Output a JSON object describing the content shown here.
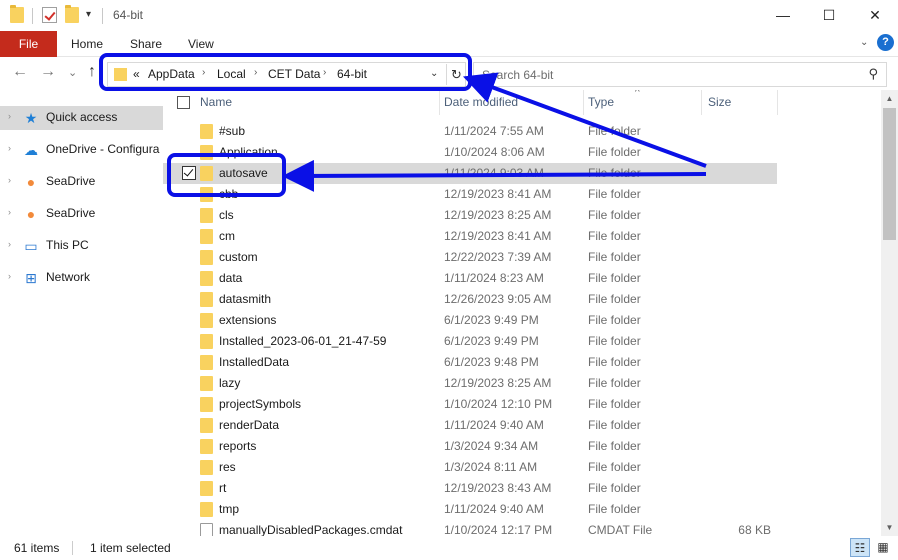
{
  "window": {
    "title": "64-bit",
    "minimize_glyph": "—",
    "maximize_glyph": "☐",
    "close_glyph": "✕",
    "qat_dropdown_glyph": "▾"
  },
  "ribbon": {
    "tabs": [
      "File",
      "Home",
      "Share",
      "View"
    ],
    "expand_glyph": "⌄",
    "help_glyph": "?"
  },
  "nav": {
    "back_glyph": "←",
    "forward_glyph": "→",
    "recent_glyph": "⌄",
    "up_glyph": "↑",
    "overflow_glyph": "«",
    "crumb_separator": "›",
    "breadcrumbs": [
      "AppData",
      "Local",
      "CET Data",
      "64-bit"
    ],
    "dropdown_glyph": "⌄",
    "refresh_glyph": "↻",
    "search_placeholder": "Search 64-bit",
    "search_glyph": "⚲"
  },
  "sidebar": {
    "expand_glyph": "›",
    "items": [
      {
        "label": "Quick access",
        "icon": "star-icon",
        "glyph": "★",
        "color": "#1e7fd6",
        "active": true
      },
      {
        "label": "OneDrive - Configura",
        "icon": "cloud-icon",
        "glyph": "☁",
        "color": "#1e7fd6",
        "active": false
      },
      {
        "label": "SeaDrive",
        "icon": "seadrive-icon",
        "glyph": "●",
        "color": "#f28a3b",
        "active": false
      },
      {
        "label": "SeaDrive",
        "icon": "seadrive-icon",
        "glyph": "●",
        "color": "#f28a3b",
        "active": false
      },
      {
        "label": "This PC",
        "icon": "computer-icon",
        "glyph": "▭",
        "color": "#2b78d0",
        "active": false
      },
      {
        "label": "Network",
        "icon": "network-icon",
        "glyph": "⊞",
        "color": "#2b78d0",
        "active": false
      }
    ]
  },
  "list": {
    "columns": {
      "name": "Name",
      "date": "Date modified",
      "type": "Type",
      "size": "Size"
    },
    "sort_glyph": "^",
    "rows": [
      {
        "name": "#sub",
        "date": "1/11/2024 7:55 AM",
        "type": "File folder",
        "size": "",
        "kind": "folder"
      },
      {
        "name": "Application",
        "date": "1/10/2024 8:06 AM",
        "type": "File folder",
        "size": "",
        "kind": "folder"
      },
      {
        "name": "autosave",
        "date": "1/11/2024 9:03 AM",
        "type": "File folder",
        "size": "",
        "kind": "folder",
        "selected": true
      },
      {
        "name": "cbb",
        "date": "12/19/2023 8:41 AM",
        "type": "File folder",
        "size": "",
        "kind": "folder"
      },
      {
        "name": "cls",
        "date": "12/19/2023 8:25 AM",
        "type": "File folder",
        "size": "",
        "kind": "folder"
      },
      {
        "name": "cm",
        "date": "12/19/2023 8:41 AM",
        "type": "File folder",
        "size": "",
        "kind": "folder"
      },
      {
        "name": "custom",
        "date": "12/22/2023 7:39 AM",
        "type": "File folder",
        "size": "",
        "kind": "folder"
      },
      {
        "name": "data",
        "date": "1/11/2024 8:23 AM",
        "type": "File folder",
        "size": "",
        "kind": "folder"
      },
      {
        "name": "datasmith",
        "date": "12/26/2023 9:05 AM",
        "type": "File folder",
        "size": "",
        "kind": "folder"
      },
      {
        "name": "extensions",
        "date": "6/1/2023 9:49 PM",
        "type": "File folder",
        "size": "",
        "kind": "folder"
      },
      {
        "name": "Installed_2023-06-01_21-47-59",
        "date": "6/1/2023 9:49 PM",
        "type": "File folder",
        "size": "",
        "kind": "folder"
      },
      {
        "name": "InstalledData",
        "date": "6/1/2023 9:48 PM",
        "type": "File folder",
        "size": "",
        "kind": "folder"
      },
      {
        "name": "lazy",
        "date": "12/19/2023 8:25 AM",
        "type": "File folder",
        "size": "",
        "kind": "folder"
      },
      {
        "name": "projectSymbols",
        "date": "1/10/2024 12:10 PM",
        "type": "File folder",
        "size": "",
        "kind": "folder"
      },
      {
        "name": "renderData",
        "date": "1/11/2024 9:40 AM",
        "type": "File folder",
        "size": "",
        "kind": "folder"
      },
      {
        "name": "reports",
        "date": "1/3/2024 9:34 AM",
        "type": "File folder",
        "size": "",
        "kind": "folder"
      },
      {
        "name": "res",
        "date": "1/3/2024 8:11 AM",
        "type": "File folder",
        "size": "",
        "kind": "folder"
      },
      {
        "name": "rt",
        "date": "12/19/2023 8:43 AM",
        "type": "File folder",
        "size": "",
        "kind": "folder"
      },
      {
        "name": "tmp",
        "date": "1/11/2024 9:40 AM",
        "type": "File folder",
        "size": "",
        "kind": "folder"
      },
      {
        "name": "manuallyDisabledPackages.cmdat",
        "date": "1/10/2024 12:17 PM",
        "type": "CMDAT File",
        "size": "68 KB",
        "kind": "file"
      }
    ]
  },
  "scrollbar": {
    "up_glyph": "▲",
    "down_glyph": "▼"
  },
  "status": {
    "item_count": "61 items",
    "selection": "1 item selected",
    "details_view_glyph": "☷",
    "icons_view_glyph": "▦"
  },
  "colors": {
    "annotation": "#0a10e6",
    "file_tab": "#c42b1c",
    "folder": "#f9d25f",
    "selection": "#d9d9d9"
  }
}
